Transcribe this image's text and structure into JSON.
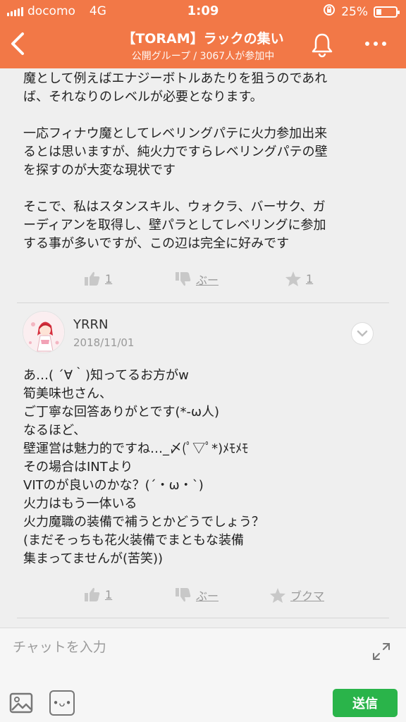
{
  "status_bar": {
    "carrier": "docomo",
    "network": "4G",
    "time": "1:09",
    "battery": "25%",
    "battery_level": 0.25
  },
  "nav": {
    "title": "【TORAM】ラックの集い",
    "subtitle": "公開グループ / 3067人が参加中"
  },
  "posts": [
    {
      "text": "魔として例えばエナジーボトルあたりを狙うのであれ\nば、それなりのレベルが必要となります。\n\n一応フィナウ魔としてレベリングパテに火力参加出来\nるとは思いますが、純火力ですらレベリングパテの壁\nを探すのが大変な現状です\n\nそこで、私はスタンスキル、ウォクラ、バーサク、ガ\nーディアンを取得し、壁パラとしてレベリングに参加\nする事が多いですが、この辺は完全に好みです",
      "like_count": "1",
      "dislike_label": "ぶー",
      "star_label": "1"
    },
    {
      "author": "YRRN",
      "date": "2018/11/01",
      "text": "あ…( ´∀｀)知ってるお方がw\n筍美味也さん、\nご丁寧な回答ありがとです(*-ω人)\nなるほど、\n壁運営は魅力的ですね…_〆(ﾟ▽ﾟ*)ﾒﾓﾒﾓ\nその場合はINTより\nVITのが良いのかな？(´・ω・`)\n火力はもう一体いる\n火力魔職の装備で補うとかどうでしょう？\n(まだそっちも花火装備でまともな装備\n集まってませんが(苦笑))",
      "like_count": "1",
      "dislike_label": "ぶー",
      "star_label": "ブクマ"
    }
  ],
  "chat": {
    "placeholder": "チャットを入力",
    "send_label": "送信"
  },
  "colors": {
    "header": "#f27847",
    "send": "#2ab44a"
  }
}
